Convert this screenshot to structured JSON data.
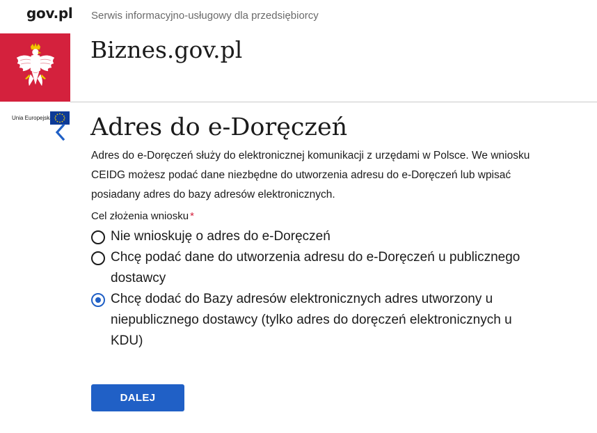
{
  "header": {
    "gov_logo": "gov.pl",
    "tagline": "Serwis informacyjno-usługowy dla przedsiębiorcy",
    "site_title": "Biznes.gov.pl",
    "eu_label": "Unia Europejska"
  },
  "main": {
    "title": "Adres do e-Doręczeń",
    "intro": "Adres do e-Doręczeń służy do elektronicznej komunikacji z urzędami w Polsce. We wniosku CEIDG możesz podać dane niezbędne do utworzenia adresu do e-Doręczeń lub wpisać posiadany adres do bazy adresów elektronicznych.",
    "field_label": "Cel złożenia wniosku",
    "required_mark": "*",
    "options": [
      {
        "label": "Nie wnioskuję o adres do e-Doręczeń",
        "selected": false
      },
      {
        "label": "Chcę podać dane do utworzenia adresu do e-Doręczeń u publicznego dostawcy",
        "selected": false
      },
      {
        "label": "Chcę dodać do Bazy adresów elektronicznych adres utworzony u niepublicznego dostawcy (tylko adres do doręczeń elektronicznych u KDU)",
        "selected": true
      }
    ],
    "next_label": "DALEJ"
  },
  "colors": {
    "brand_red": "#d4213d",
    "accent_blue": "#2060c6",
    "eu_blue": "#0d3a97",
    "eu_gold": "#f5d300"
  },
  "icons": {
    "emblem": "polish-white-eagle-icon",
    "eu_flag": "eu-flag-icon",
    "back": "chevron-left-icon"
  }
}
